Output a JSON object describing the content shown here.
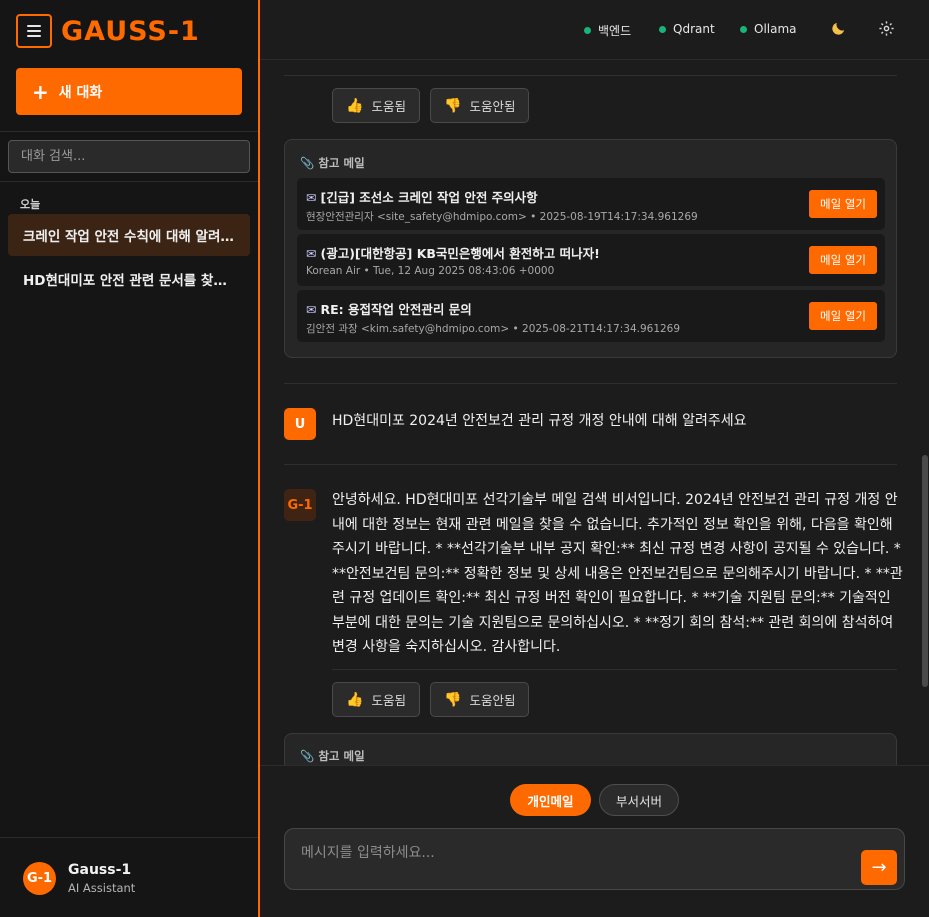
{
  "brand": {
    "title": "GAUSS-1",
    "accent": "#ff6a00"
  },
  "sidebar": {
    "new_chat_label": "새 대화",
    "search_placeholder": "대화 검색...",
    "section_today": "오늘",
    "conversations": [
      {
        "title": "크레인 작업 안전 수칙에 대해 알려주세요",
        "active": true
      },
      {
        "title": "HD현대미포 안전 관련 문서를 찾아주세요",
        "active": false
      }
    ],
    "profile": {
      "avatar": "G-1",
      "name": "Gauss-1",
      "role": "AI Assistant"
    }
  },
  "header": {
    "statuses": [
      {
        "label": "백엔드",
        "color": "#18b57a"
      },
      {
        "label": "Qdrant",
        "color": "#18b57a"
      },
      {
        "label": "Ollama",
        "color": "#18b57a"
      }
    ],
    "theme_icon": "moon-icon",
    "settings_icon": "gear-icon"
  },
  "feedback": {
    "helpful": "도움됨",
    "not_helpful": "도움안됨"
  },
  "refs": {
    "title": "참고 메일",
    "open_label": "메일 열기",
    "items": [
      {
        "subject": "[긴급] 조선소 크레인 작업 안전 주의사항",
        "meta": "현장안전관리자 <site_safety@hdmipo.com> • 2025-08-19T14:17:34.961269"
      },
      {
        "subject": "(광고)[대한항공] KB국민은행에서 환전하고 떠나자!",
        "meta": "Korean Air • Tue, 12 Aug 2025 08:43:06 +0000"
      },
      {
        "subject": "RE: 용접작업 안전관리 문의",
        "meta": "김안전 과장 <kim.safety@hdmipo.com> • 2025-08-21T14:17:34.961269"
      }
    ]
  },
  "messages": {
    "user": {
      "avatar": "U",
      "text": "HD현대미포 2024년 안전보건 관리 규정 개정 안내에 대해 알려주세요"
    },
    "assistant": {
      "avatar": "G-1",
      "text": "안녕하세요. HD현대미포 선각기술부 메일 검색 비서입니다. 2024년 안전보건 관리 규정 개정 안내에 대한 정보는 현재 관련 메일을 찾을 수 없습니다. 추가적인 정보 확인을 위해, 다음을 확인해주시기 바랍니다. * **선각기술부 내부 공지 확인:** 최신 규정 변경 사항이 공지될 수 있습니다. * **안전보건팀 문의:** 정확한 정보 및 상세 내용은 안전보건팀으로 문의해주시기 바랍니다. * **관련 규정 업데이트 확인:** 최신 규정 버전 확인이 필요합니다. * **기술 지원팀 문의:** 기술적인 부분에 대한 문의는 기술 지원팀으로 문의하십시오. * **정기 회의 참석:** 관련 회의에 참석하여 변경 사항을 숙지하십시오. 감사합니다."
    }
  },
  "composer": {
    "mode_personal": "개인메일",
    "mode_dept": "부서서버",
    "placeholder": "메시지를 입력하세요...",
    "send_icon": "→"
  }
}
